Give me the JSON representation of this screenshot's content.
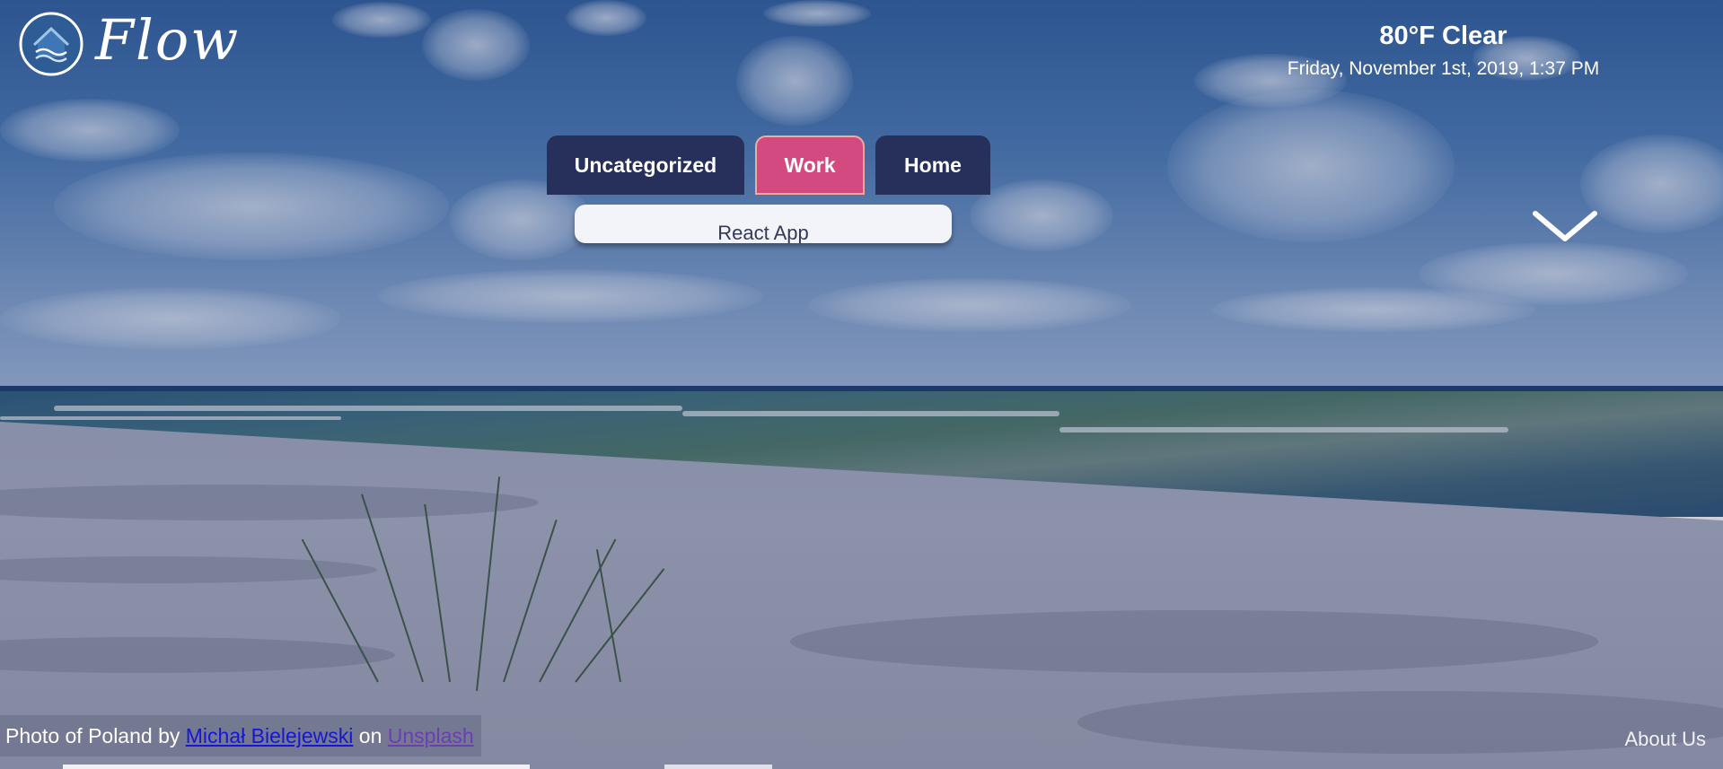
{
  "brand": {
    "name": "Flow",
    "logo_icon": "house-waves-icon"
  },
  "weather": {
    "condition": "80°F Clear",
    "datetime": "Friday, November 1st, 2019, 1:37 PM"
  },
  "tabs": [
    {
      "label": "Uncategorized",
      "active": false
    },
    {
      "label": "Work",
      "active": true
    },
    {
      "label": "Home",
      "active": false
    }
  ],
  "apps": [
    {
      "label": "React App"
    }
  ],
  "expand_icon": "chevron-down-icon",
  "credits": {
    "prefix": "Photo of Poland by ",
    "author": "Michał Bielejewski",
    "connector": " on ",
    "source": "Unsplash"
  },
  "footer": {
    "about_label": "About Us"
  },
  "colors": {
    "tab_bg": "#26305a",
    "tab_active_bg": "#d24a80",
    "tab_active_border": "#f2a9a0",
    "link": "#1616d8",
    "link_visited": "#6a3fb0"
  }
}
